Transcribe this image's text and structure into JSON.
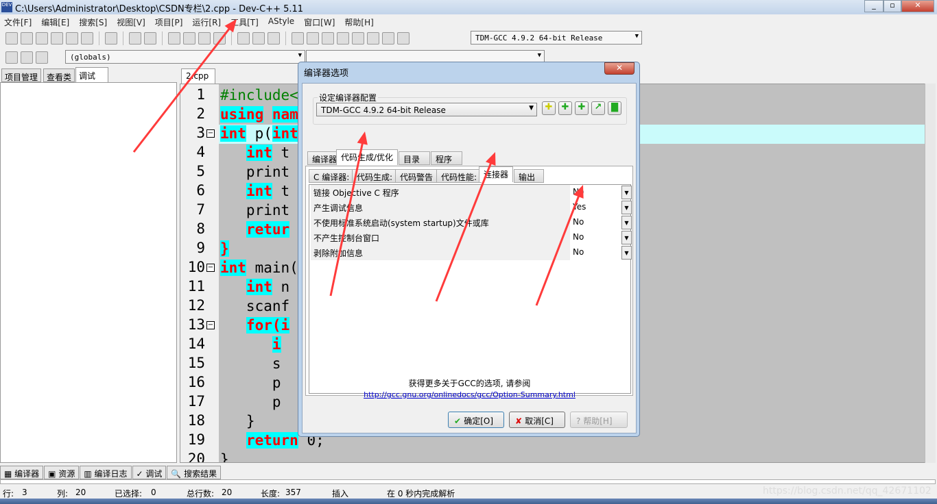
{
  "window": {
    "title": "C:\\Users\\Administrator\\Desktop\\CSDN专栏\\2.cpp - Dev-C++ 5.11",
    "icon_label": "DEV"
  },
  "menu": [
    "文件[F]",
    "编辑[E]",
    "搜索[S]",
    "视图[V]",
    "项目[P]",
    "运行[R]",
    "工具[T]",
    "AStyle",
    "窗口[W]",
    "帮助[H]"
  ],
  "toolbar": {
    "compiler_select": "TDM-GCC 4.9.2 64-bit Release",
    "scope_select": "(globals)",
    "member_select": ""
  },
  "left_tabs": [
    "项目管理",
    "查看类",
    "调试"
  ],
  "editor": {
    "tab": "2.cpp",
    "lines": [
      [
        [
          "inc",
          "#include<"
        ]
      ],
      [
        [
          "kw",
          "using"
        ],
        [
          "",
          " "
        ],
        [
          "kw",
          "nam"
        ]
      ],
      [
        [
          "kw",
          "int"
        ],
        [
          "",
          " p("
        ],
        [
          "kw",
          "int"
        ]
      ],
      [
        [
          "",
          "   "
        ],
        [
          "kw",
          "int"
        ],
        [
          "",
          " t"
        ]
      ],
      [
        [
          "",
          "   print"
        ]
      ],
      [
        [
          "",
          "   "
        ],
        [
          "kw",
          "int"
        ],
        [
          "",
          " t"
        ]
      ],
      [
        [
          "",
          "   print"
        ]
      ],
      [
        [
          "",
          "   "
        ],
        [
          "kw",
          "retur"
        ]
      ],
      [
        [
          "kw",
          "}"
        ]
      ],
      [
        [
          "kw",
          "int"
        ],
        [
          "",
          " main("
        ]
      ],
      [
        [
          "",
          "   "
        ],
        [
          "kw",
          "int"
        ],
        [
          "",
          " n"
        ]
      ],
      [
        [
          "",
          "   scanf"
        ]
      ],
      [
        [
          "",
          "   "
        ],
        [
          "kw",
          "for(i"
        ]
      ],
      [
        [
          "",
          "      "
        ],
        [
          "kw",
          "i"
        ]
      ],
      [
        [
          "",
          "      s"
        ]
      ],
      [
        [
          "",
          "      p"
        ]
      ],
      [
        [
          "",
          "      p"
        ]
      ],
      [
        [
          "",
          "   }"
        ]
      ],
      [
        [
          "",
          "   "
        ],
        [
          "kw",
          "return"
        ],
        [
          "",
          " 0;"
        ]
      ],
      [
        [
          "",
          "}"
        ]
      ]
    ],
    "current_line": 3
  },
  "bottom_tabs": [
    "编译器",
    "资源",
    "编译日志",
    "调试",
    "搜索结果"
  ],
  "status": {
    "row_label": "行:",
    "row": "3",
    "col_label": "列:",
    "col": "20",
    "sel_label": "已选择:",
    "sel": "0",
    "total_label": "总行数:",
    "total": "20",
    "len_label": "长度:",
    "len": "357",
    "mode": "插入",
    "parse": "在 0 秒内完成解析",
    "watermark": "https://blog.csdn.net/qq_42671102"
  },
  "dialog": {
    "title": "编译器选项",
    "close": "✕",
    "config_label": "设定编译器配置",
    "config_value": "TDM-GCC 4.9.2 64-bit Release",
    "tabs": [
      "编译器",
      "代码生成/优化",
      "目录",
      "程序"
    ],
    "subtabs": [
      "C 编译器:",
      "代码生成:",
      "代码警告",
      "代码性能:",
      "连接器",
      "输出"
    ],
    "options": [
      {
        "name": "链接 Objective C 程序",
        "value": "No"
      },
      {
        "name": "产生调试信息",
        "value": "Yes"
      },
      {
        "name": "不使用标准系统启动(system startup)文件或库",
        "value": "No"
      },
      {
        "name": "不产生控制台窗口",
        "value": "No"
      },
      {
        "name": "剥除附加信息",
        "value": "No"
      }
    ],
    "more_info": "获得更多关于GCC的选项, 请参阅",
    "link": "http://gcc.gnu.org/onlinedocs/gcc/Option-Summary.html",
    "ok": "确定[O]",
    "cancel": "取消[C]",
    "help": "帮助[H]"
  },
  "colors": {
    "annotation_arrow": "#ff3b3b",
    "keyword_bg": "#00ffff",
    "keyword_fg": "#ff0000",
    "current_line": "#cafbfb"
  }
}
